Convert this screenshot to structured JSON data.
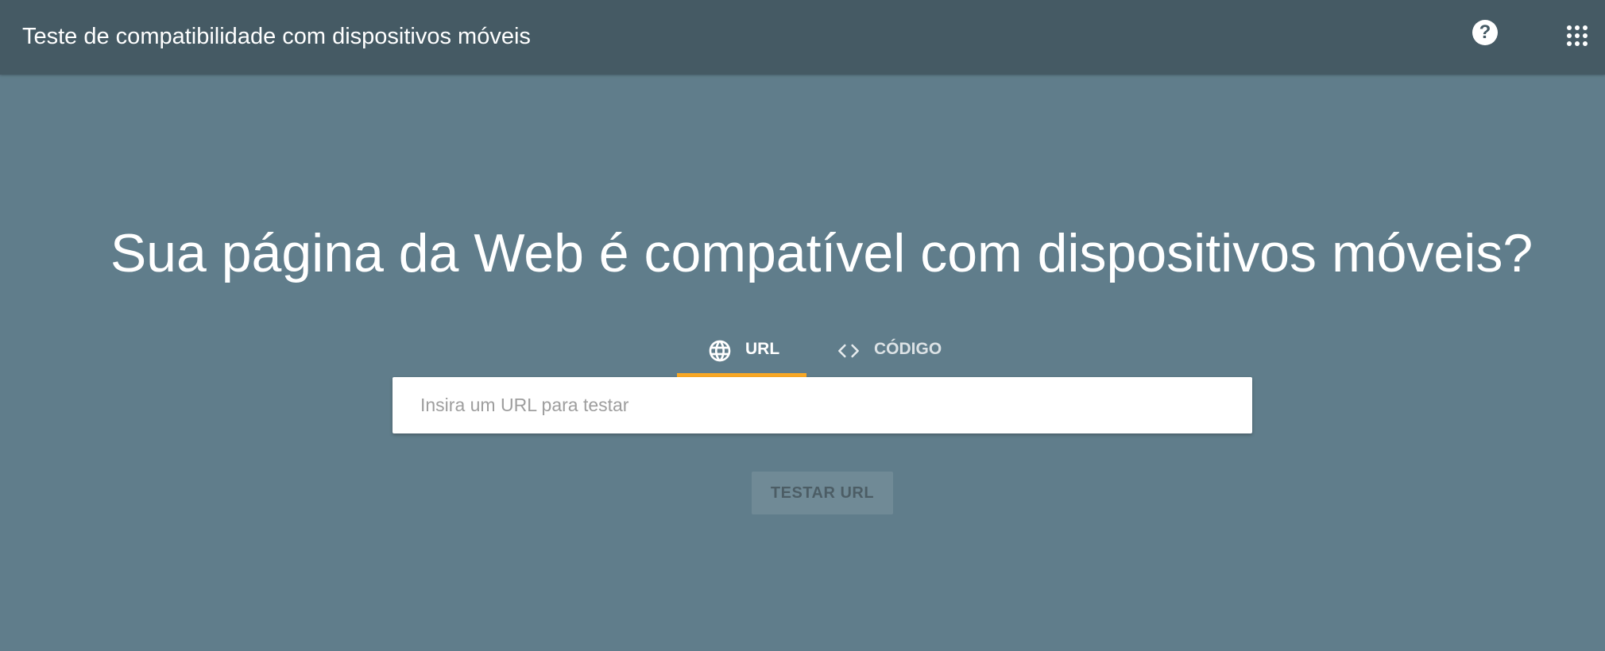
{
  "header": {
    "title": "Teste de compatibilidade com dispositivos móveis",
    "help_icon": "help-icon",
    "help_symbol": "?",
    "apps_icon": "apps-grid-icon"
  },
  "main": {
    "headline": "Sua página da Web é compatível com dispositivos móveis?",
    "tabs": [
      {
        "label": "URL",
        "icon": "globe-icon",
        "active": true
      },
      {
        "label": "CÓDIGO",
        "icon": "code-icon",
        "active": false
      }
    ],
    "input": {
      "value": "",
      "placeholder": "Insira um URL para testar"
    },
    "submit_label": "TESTAR URL"
  },
  "colors": {
    "header_bg": "#455a64",
    "page_bg": "#607d8b",
    "tab_indicator": "#f9a825",
    "text": "#ffffff"
  }
}
